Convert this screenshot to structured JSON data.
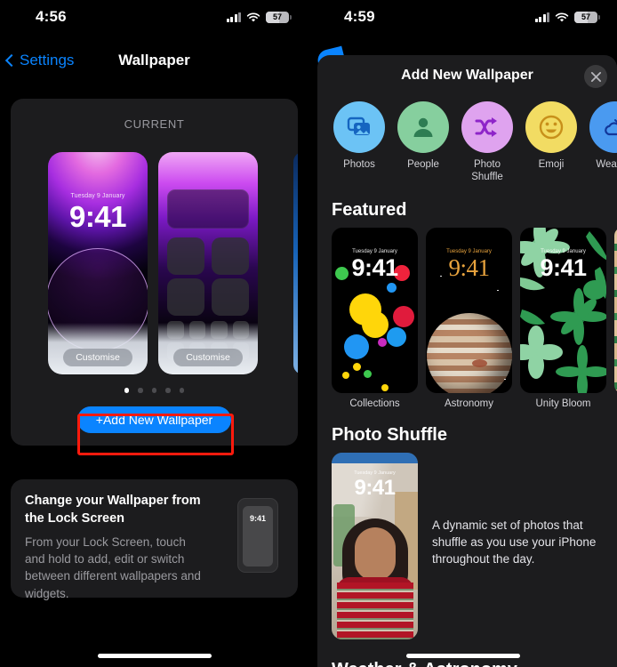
{
  "left": {
    "status": {
      "time": "4:56",
      "battery": "57",
      "cellular_icon": "cellular-bars-icon",
      "wifi_icon": "wifi-icon",
      "battery_icon": "battery-icon"
    },
    "nav": {
      "back_label": "Settings",
      "title": "Wallpaper",
      "back_icon": "chevron-left-icon"
    },
    "current": {
      "section_label": "CURRENT",
      "lock_preview": {
        "date": "Tuesday 9 January",
        "time": "9:41",
        "customise_label": "Customise"
      },
      "home_preview": {
        "customise_label": "Customise"
      },
      "page_dots": 5,
      "active_dot": 0,
      "add_button_label": "+Add New Wallpaper",
      "add_button_color": "#0a84ff",
      "highlight_color": "#ff1a0d"
    },
    "info": {
      "title": "Change your Wallpaper from the Lock Screen",
      "body": "From your Lock Screen, touch and hold to add, edit or switch between different wallpapers and widgets.",
      "phone_time": "9:41"
    }
  },
  "right": {
    "status": {
      "time": "4:59",
      "battery": "57"
    },
    "sheet": {
      "title": "Add New Wallpaper",
      "close_icon": "close-icon"
    },
    "categories": [
      {
        "label": "Photos",
        "icon": "photos-icon",
        "circle": "#6cc3f5",
        "glyph": "#1565c0"
      },
      {
        "label": "People",
        "icon": "person-icon",
        "circle": "#86cf9e",
        "glyph": "#2e7d53"
      },
      {
        "label": "Photo Shuffle",
        "icon": "shuffle-icon",
        "circle": "#dfa3ef",
        "glyph": "#8e24c9"
      },
      {
        "label": "Emoji",
        "icon": "emoji-smile-icon",
        "circle": "#f2dc63",
        "glyph": "#c8901a"
      },
      {
        "label": "Weather",
        "icon": "weather-icon",
        "circle": "#4a9af0",
        "glyph": "#12379a"
      }
    ],
    "featured": {
      "title": "Featured",
      "items": [
        {
          "label": "Collections",
          "date": "Tuesday 9 January",
          "time": "9:41"
        },
        {
          "label": "Astronomy",
          "date": "Tuesday 9 January",
          "time": "9:41"
        },
        {
          "label": "Unity Bloom",
          "date": "Tuesday 9 January",
          "time": "9:41"
        },
        {
          "label": "",
          "date": "",
          "time": ""
        }
      ]
    },
    "photo_shuffle": {
      "title": "Photo Shuffle",
      "description": "A dynamic set of photos that shuffle as you use your iPhone throughout the day.",
      "preview": {
        "date": "Tuesday 9 January",
        "time": "9:41"
      }
    },
    "next_section_title": "Weather & Astronomy"
  }
}
